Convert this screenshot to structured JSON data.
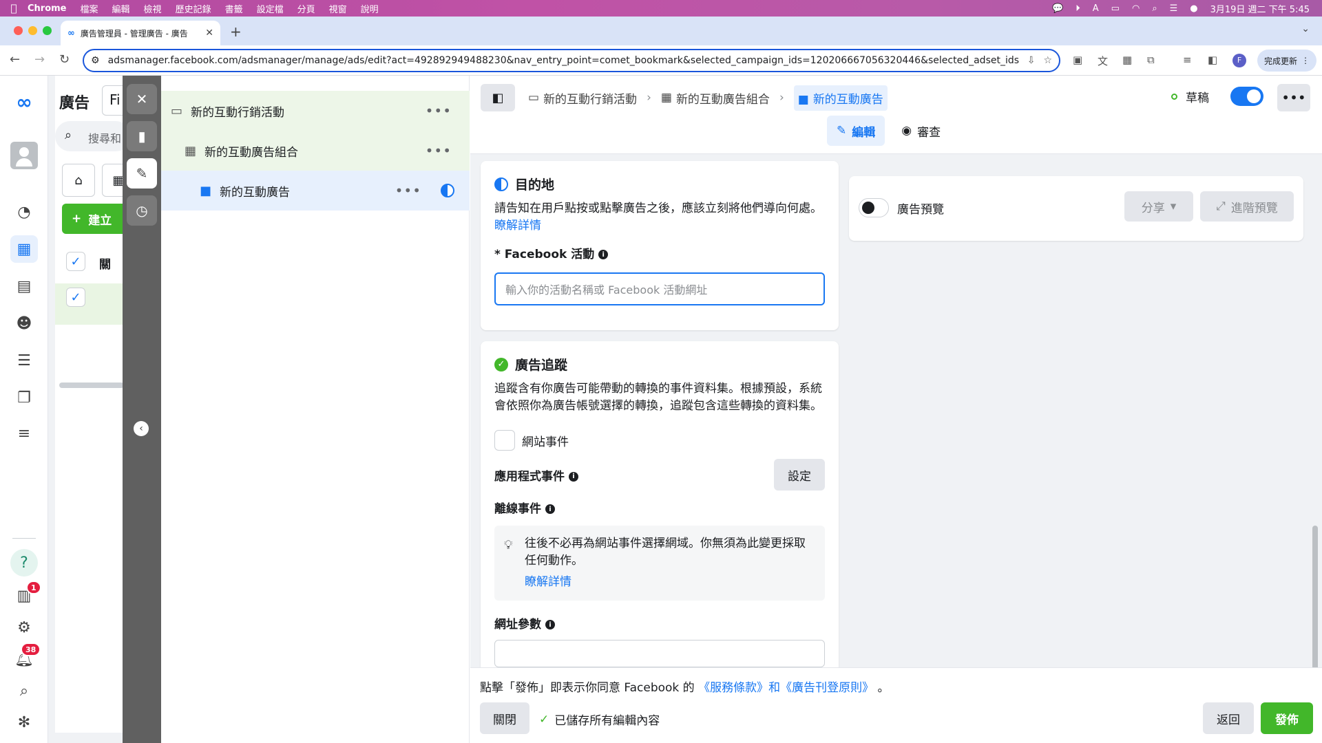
{
  "menubar": {
    "apple": "",
    "items": [
      "Chrome",
      "檔案",
      "編輯",
      "檢視",
      "歷史記錄",
      "書籤",
      "設定檔",
      "分頁",
      "視窗",
      "說明"
    ],
    "clock": "3月19日 週二 下午 5:45",
    "input_method": "A"
  },
  "browser": {
    "tab_title": "廣告管理員 - 管理廣告 - 廣告",
    "tab_favicon": "∞",
    "url": "adsmanager.facebook.com/adsmanager/manage/ads/edit?act=492892949488230&nav_entry_point=comet_bookmark&selected_campaign_ids=120206667056320446&selected_adset_ids=1202...",
    "update_label": "完成更新",
    "profile_initial": "F"
  },
  "rail": {
    "notifications_badge": "1",
    "alerts_badge": "38"
  },
  "background_panel": {
    "title": "廣告",
    "selector_text": "Fi",
    "search_placeholder": "搜尋和",
    "create_label": "建立",
    "column_header": "關"
  },
  "tree": {
    "campaign": "新的互動行銷活動",
    "adset": "新的互動廣告組合",
    "ad": "新的互動廣告"
  },
  "header": {
    "crumb_campaign": "新的互動行銷活動",
    "crumb_adset": "新的互動廣告組合",
    "crumb_ad": "新的互動廣告",
    "status": "草稿",
    "tab_edit": "編輯",
    "tab_review": "審查"
  },
  "destination": {
    "title": "目的地",
    "description": "請告知在用戶點按或點擊廣告之後，應該立刻將他們導向何處。",
    "learn_more": "瞭解詳情",
    "field_label": "* Facebook 活動",
    "placeholder": "輸入你的活動名稱或 Facebook 活動網址"
  },
  "tracking": {
    "title": "廣告追蹤",
    "description": "追蹤含有你廣告可能帶動的轉換的事件資料集。根據預設，系統會依照你為廣告帳號選擇的轉換，追蹤包含這些轉換的資料集。",
    "website_events": "網站事件",
    "app_events": "應用程式事件",
    "setup_button": "設定",
    "offline_events": "離線事件",
    "tip": "往後不必再為網站事件選擇網域。你無須為此變更採取任何動作。",
    "tip_link": "瞭解詳情",
    "url_params": "網址參數"
  },
  "preview": {
    "label": "廣告預覽",
    "share": "分享",
    "advanced": "進階預覽"
  },
  "footer": {
    "terms_prefix": "點擊「發佈」即表示你同意 Facebook 的",
    "terms_link": "《服務條款》和《廣告刊登原則》",
    "terms_suffix": "。",
    "close": "關閉",
    "saved": "已儲存所有編輯內容",
    "back": "返回",
    "publish": "發佈"
  },
  "colors": {
    "brand_blue": "#1877f2",
    "publish_green": "#42b72a",
    "menubar": "#b14aa0"
  }
}
